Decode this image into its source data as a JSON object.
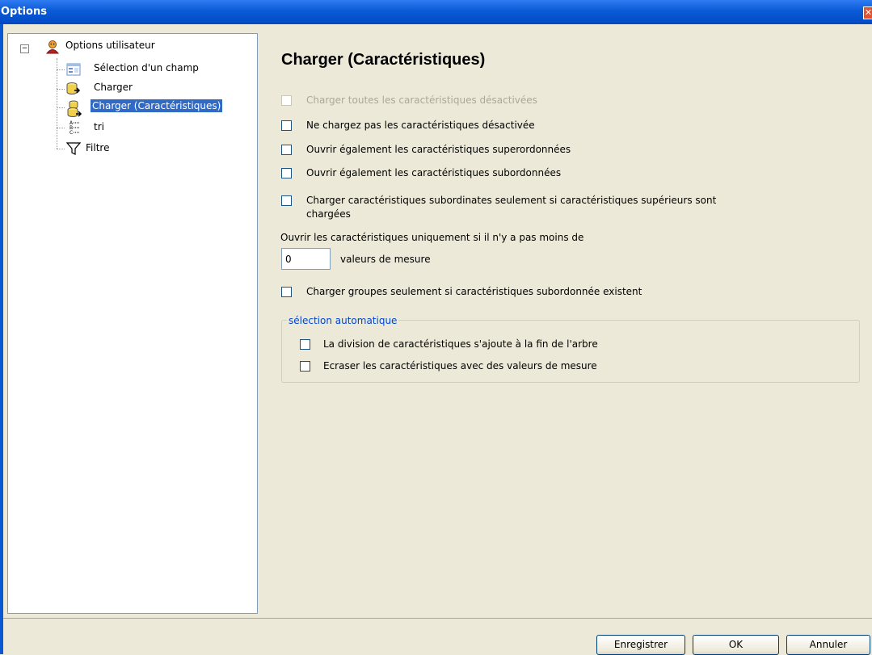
{
  "window": {
    "title": "Options",
    "close_glyph": "✕"
  },
  "tree": {
    "expander_glyph": "−",
    "root": {
      "label": "Options utilisateur",
      "icon": "user-icon"
    },
    "children": [
      {
        "label": "Sélection d'un champ",
        "icon": "field-selection-icon"
      },
      {
        "label": "Charger",
        "icon": "load-icon"
      },
      {
        "label": "Charger (Caractéristiques)",
        "icon": "load-characteristics-icon",
        "selected": true
      },
      {
        "label": "tri",
        "icon": "sort-icon"
      },
      {
        "label": "Filtre",
        "icon": "filter-icon"
      }
    ]
  },
  "main": {
    "heading": "Charger (Caractéristiques)",
    "options": [
      {
        "label": "Charger toutes les caractéristiques désactivées",
        "checked": false,
        "disabled": true
      },
      {
        "label": "Ne chargez pas les caractéristiques désactivée",
        "checked": false
      },
      {
        "label": "Ouvrir également les caractéristiques superordonnées",
        "checked": false
      },
      {
        "label": "Ouvrir également les caractéristiques subordonnées",
        "checked": false
      },
      {
        "label": "Charger caractéristiques subordinates seulement si caractéristiques supérieurs sont",
        "label_line2": "chargées",
        "checked": false
      }
    ],
    "min_values": {
      "label": "Ouvrir les caractéristiques uniquement si il n'y a pas moins de",
      "value": "0",
      "suffix": "valeurs de mesure"
    },
    "groups_option": {
      "label": "Charger groupes seulement si caractéristiques subordonnée existent",
      "checked": false
    },
    "auto_selection": {
      "legend": "sélection automatique",
      "options": [
        {
          "label": "La division de caractéristiques s'ajoute à la fin de l'arbre",
          "checked": false
        },
        {
          "label": "Ecraser les caractéristiques avec des valeurs de mesure",
          "checked": false
        }
      ]
    }
  },
  "buttons": {
    "save": "Enregistrer",
    "ok": "OK",
    "cancel": "Annuler"
  }
}
